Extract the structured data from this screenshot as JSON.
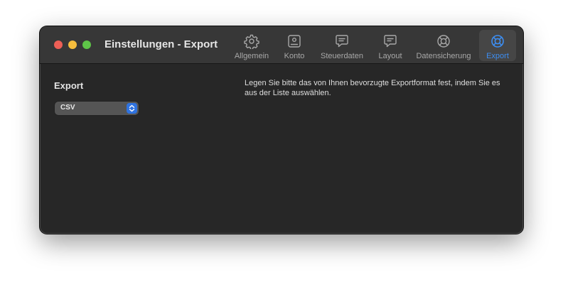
{
  "window": {
    "title": "Einstellungen - Export"
  },
  "toolbar": {
    "items": [
      {
        "label": "Allgemein",
        "icon": "gear-icon",
        "active": false
      },
      {
        "label": "Konto",
        "icon": "account-card-icon",
        "active": false
      },
      {
        "label": "Steuerdaten",
        "icon": "message-bubble-icon",
        "active": false
      },
      {
        "label": "Layout",
        "icon": "layout-bubble-icon",
        "active": false
      },
      {
        "label": "Datensicherung",
        "icon": "lifebuoy-icon",
        "active": false
      },
      {
        "label": "Export",
        "icon": "export-lifebuoy-icon",
        "active": true
      }
    ]
  },
  "export": {
    "section_title": "Export",
    "format_selected": "CSV",
    "description": "Legen Sie bitte das von Ihnen bevorzugte Exportformat fest, indem Sie es aus der Liste auswählen."
  },
  "colors": {
    "window_bg": "#272727",
    "titlebar_bg": "#373737",
    "accent": "#3d8ef2",
    "close": "#ed5f56",
    "minimize": "#f5bd3d",
    "zoom": "#5ec548"
  }
}
